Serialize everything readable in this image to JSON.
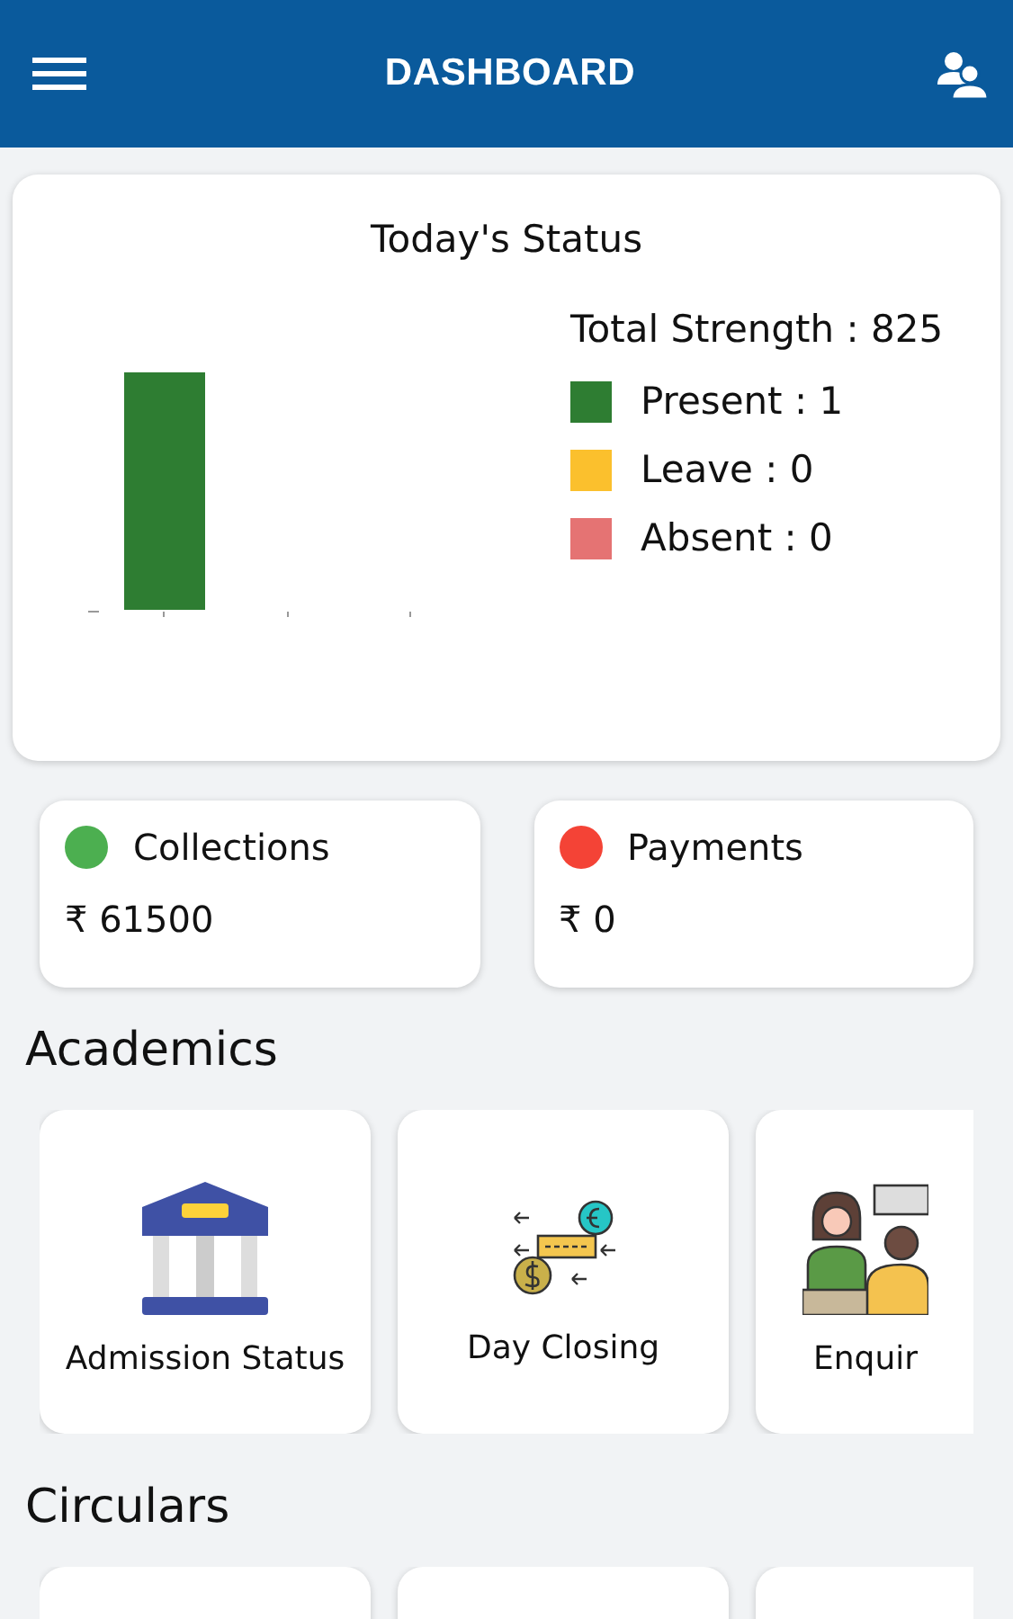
{
  "header": {
    "title": "DASHBOARD"
  },
  "status": {
    "title": "Today's Status",
    "total": "Total Strength : 825",
    "legend": [
      {
        "label": "Present : 1",
        "color": "#2e7d32"
      },
      {
        "label": "Leave : 0",
        "color": "#fbc02d"
      },
      {
        "label": "Absent : 0",
        "color": "#e57373"
      }
    ]
  },
  "summary": [
    {
      "label": "Collections",
      "color": "#4caf50",
      "amount": "₹ 61500"
    },
    {
      "label": "Payments",
      "color": "#f44336",
      "amount": "₹ 0"
    }
  ],
  "academics": {
    "title": "Academics",
    "items": [
      {
        "kind": "bank",
        "label": "Admission Status"
      },
      {
        "kind": "fees",
        "label": "Day Closing"
      },
      {
        "kind": "desk",
        "label": "Enquir"
      }
    ]
  },
  "circulars": {
    "title": "Circulars",
    "cards": [
      {
        "kind": "blank"
      },
      {
        "kind": "blank"
      },
      {
        "kind": "blank"
      }
    ]
  }
}
